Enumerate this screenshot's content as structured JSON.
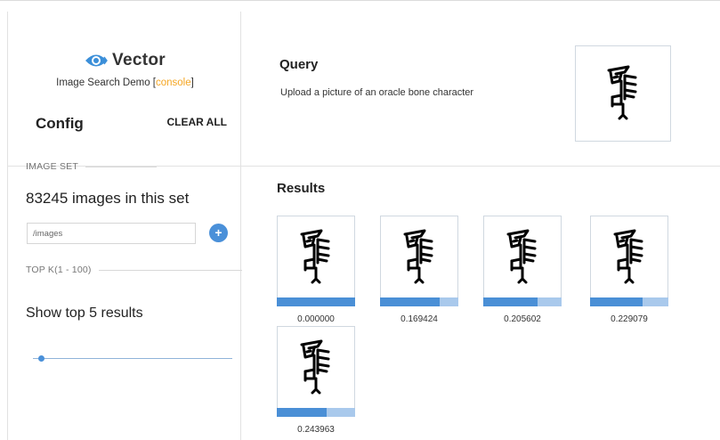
{
  "colors": {
    "accent": "#4a90d9",
    "console": "#f5a623",
    "bar_fill": "#4a8fd6",
    "bar_bg": "#a9c9ec"
  },
  "sidebar": {
    "brand": {
      "name": "Vector",
      "subtitle": "Image Search Demo [",
      "console_link": "console",
      "subtitle_end": "]"
    },
    "config_title": "Config",
    "clear_all": "CLEAR ALL",
    "image_set_label": "IMAGE SET",
    "image_count_text": "83245 images in this set",
    "path_input_value": "/images",
    "add_button": "+",
    "topk_label": "TOP K(1 - 100)",
    "show_top_text": "Show top 5 results",
    "slider": {
      "min": 1,
      "max": 100,
      "value": 5
    }
  },
  "query": {
    "title": "Query",
    "description": "Upload a picture of an oracle bone character",
    "image_icon": "oracle-bone-character-glyph"
  },
  "results": {
    "title": "Results",
    "items": [
      {
        "score": "0.000000",
        "bar_fraction": 1.0
      },
      {
        "score": "0.169424",
        "bar_fraction": 0.76
      },
      {
        "score": "0.205602",
        "bar_fraction": 0.69
      },
      {
        "score": "0.229079",
        "bar_fraction": 0.67
      },
      {
        "score": "0.243963",
        "bar_fraction": 0.64
      }
    ]
  }
}
